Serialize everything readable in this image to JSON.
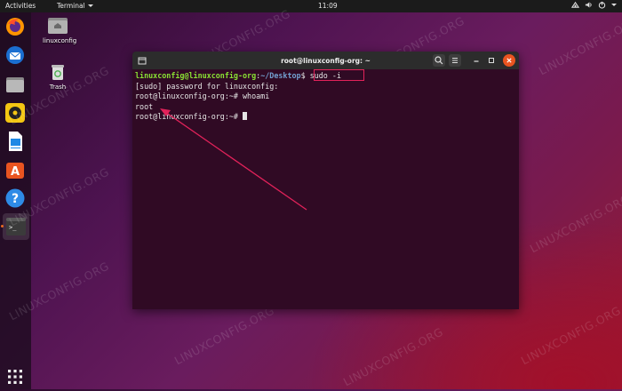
{
  "topbar": {
    "activities": "Activities",
    "app_menu": "Terminal",
    "clock": "11:09",
    "tray_icons": [
      "network-icon",
      "volume-icon",
      "power-icon",
      "chevron-down-icon"
    ]
  },
  "dock": {
    "items": [
      "firefox-icon",
      "thunderbird-icon",
      "files-icon",
      "rhythmbox-icon",
      "writer-icon",
      "software-icon",
      "help-icon",
      "terminal-icon"
    ],
    "show_apps_icon": "grid-icon"
  },
  "desktop": {
    "home_label": "linuxconfig",
    "trash_label": "Trash"
  },
  "terminal": {
    "title": "root@linuxconfig-org: ~",
    "lines": {
      "l1_user": "linuxconfig@linuxconfig-org",
      "l1_sep": ":",
      "l1_path": "~/Desktop",
      "l1_prompt": "$ ",
      "l1_cmd": "sudo -i",
      "l2": "[sudo] password for linuxconfig:",
      "l3": "root@linuxconfig-org:~# whoami",
      "l4": "root",
      "l5": "root@linuxconfig-org:~# "
    }
  },
  "watermark": "LINUXCONFIG.ORG",
  "colors": {
    "terminal_bg": "#300a24",
    "prompt_user": "#8ae234",
    "prompt_path": "#729fcf",
    "annotation": "#e2225a"
  }
}
